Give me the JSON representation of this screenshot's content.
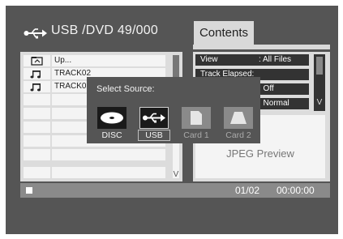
{
  "header": {
    "source_title": "USB /DVD 49/000",
    "tab_label": "Contents"
  },
  "file_list": {
    "rows": [
      {
        "icon": "folder-up-icon",
        "name": "Up..."
      },
      {
        "icon": "music-note-icon",
        "name": "TRACK02"
      },
      {
        "icon": "music-note-icon",
        "name": "TRACK03"
      },
      {
        "icon": "",
        "name": ""
      },
      {
        "icon": "",
        "name": ""
      },
      {
        "icon": "",
        "name": ""
      },
      {
        "icon": "",
        "name": ""
      },
      {
        "icon": "",
        "name": ""
      },
      {
        "icon": "",
        "name": ""
      }
    ],
    "scroll_indicator": "V"
  },
  "settings": {
    "rows": [
      {
        "label": "View",
        "value": ": All Files"
      },
      {
        "label": "Track Elapsed:",
        "value": ""
      },
      {
        "label": "",
        "value": ": Off"
      },
      {
        "label": "",
        "value": ": Normal"
      }
    ],
    "scroll_indicator": "V"
  },
  "preview": {
    "label": "JPEG Preview"
  },
  "status": {
    "page": "01/02",
    "time": "00:00:00"
  },
  "source_popup": {
    "title": "Select Source:",
    "sources": [
      {
        "label": "DISC",
        "icon": "disc-icon",
        "state": "enabled"
      },
      {
        "label": "USB",
        "icon": "usb-icon",
        "state": "selected"
      },
      {
        "label": "Card 1",
        "icon": "card-icon",
        "state": "disabled"
      },
      {
        "label": "Card 2",
        "icon": "card-icon",
        "state": "disabled"
      }
    ]
  },
  "colors": {
    "background": "#555555",
    "panel": "#dcdcdc",
    "highlight": "#333333"
  }
}
